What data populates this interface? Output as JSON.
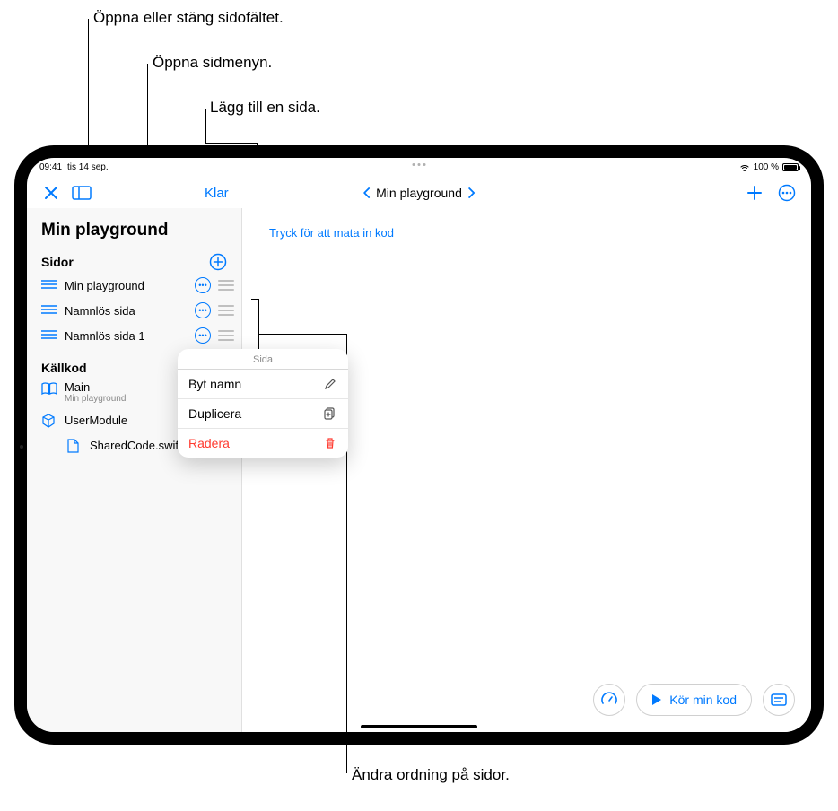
{
  "callouts": {
    "toggle_sidebar": "Öppna eller stäng sidofältet.",
    "open_pagemenu": "Öppna sidmenyn.",
    "add_page": "Lägg till en sida.",
    "reorder_pages": "Ändra ordning på sidor."
  },
  "status": {
    "time": "09:41",
    "date": "tis 14 sep.",
    "battery_pct": "100 %"
  },
  "toolbar": {
    "done_label": "Klar",
    "nav_title": "Min playground"
  },
  "sidebar": {
    "playground_title": "Min playground",
    "pages_header": "Sidor",
    "pages": [
      {
        "label": "Min playground"
      },
      {
        "label": "Namnlös sida"
      },
      {
        "label": "Namnlös sida 1"
      }
    ],
    "source_header": "Källkod",
    "main_label": "Main",
    "main_sub": "Min playground",
    "usermodule_label": "UserModule",
    "sharedcode_label": "SharedCode.swift"
  },
  "popup": {
    "title": "Sida",
    "rename": "Byt namn",
    "duplicate": "Duplicera",
    "delete": "Radera"
  },
  "main_area": {
    "hint": "Tryck för att mata in kod"
  },
  "bottom": {
    "run_label": "Kör min kod"
  }
}
